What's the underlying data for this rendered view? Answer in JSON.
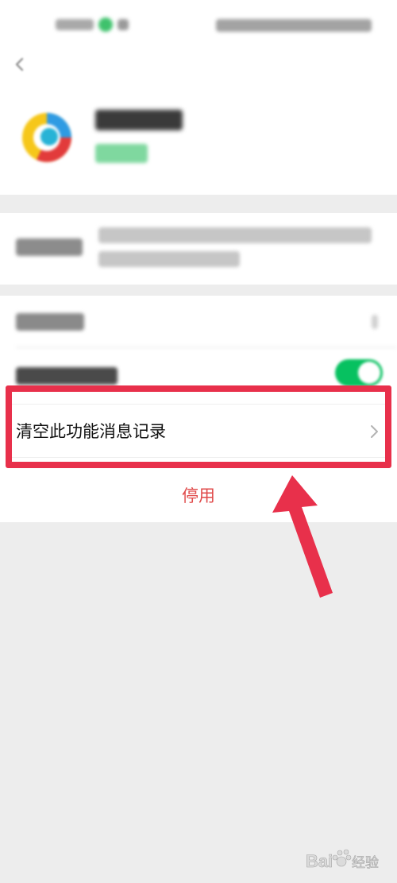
{
  "clear_row": {
    "label": "清空此功能消息记录"
  },
  "actions": {
    "disable_label": "停用"
  },
  "colors": {
    "accent_green": "#07c160",
    "danger_red": "#e04a4a",
    "highlight_red": "#e8304b"
  },
  "icons": {
    "back": "chevron-left-icon",
    "row_arrow": "chevron-right-icon",
    "annotation": "arrow-up-icon"
  }
}
